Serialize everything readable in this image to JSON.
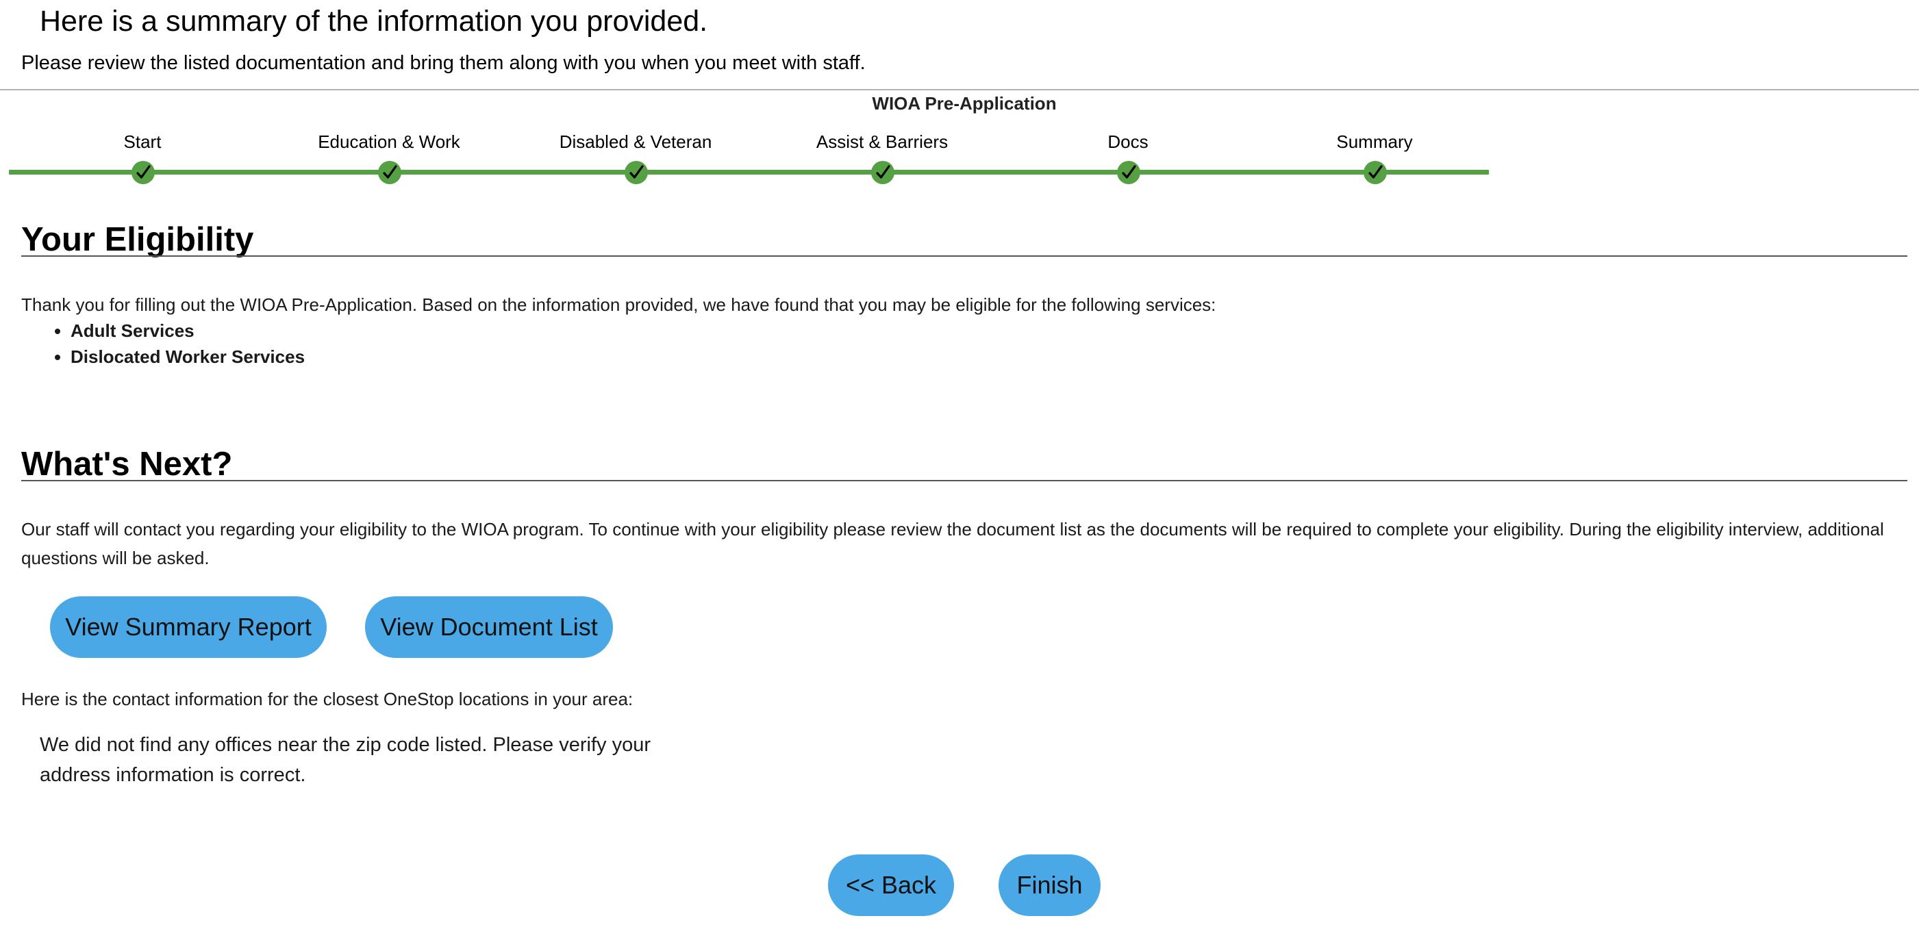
{
  "header": {
    "title": "Here is a summary of the information you provided.",
    "subtitle": "Please review the listed documentation and bring them along with you when you meet with staff."
  },
  "app": {
    "title": "WIOA Pre-Application"
  },
  "steps": [
    {
      "label": "Start",
      "status": "complete",
      "icon": "checkmark-icon"
    },
    {
      "label": "Education & Work",
      "status": "complete",
      "icon": "checkmark-icon"
    },
    {
      "label": "Disabled & Veteran",
      "status": "complete",
      "icon": "checkmark-icon"
    },
    {
      "label": "Assist & Barriers",
      "status": "complete",
      "icon": "checkmark-icon"
    },
    {
      "label": "Docs",
      "status": "complete",
      "icon": "checkmark-icon"
    },
    {
      "label": "Summary",
      "status": "complete",
      "icon": "checkmark-icon"
    }
  ],
  "eligibility": {
    "heading": "Your Eligibility",
    "intro": "Thank you for filling out the WIOA Pre-Application. Based on the information provided, we have found that you may be eligible for the following services:",
    "services": [
      "Adult Services",
      "Dislocated Worker Services"
    ]
  },
  "next": {
    "heading": "What's Next?",
    "text": "Our staff will contact you regarding your eligibility to the WIOA program. To continue with your eligibility please review the document list as the documents will be required to complete your eligibility. During the eligibility interview, additional questions will be asked.",
    "view_summary_label": "View Summary Report",
    "view_documents_label": "View Document List",
    "contact_intro": "Here is the contact information for the closest OneStop locations in your area:",
    "no_offices_message": "We did not find any offices near the zip code listed. Please verify your address information is correct."
  },
  "footer": {
    "back_label": "<< Back",
    "finish_label": "Finish"
  },
  "colors": {
    "step_complete": "#56a044",
    "button_background": "#4aa8e6"
  }
}
